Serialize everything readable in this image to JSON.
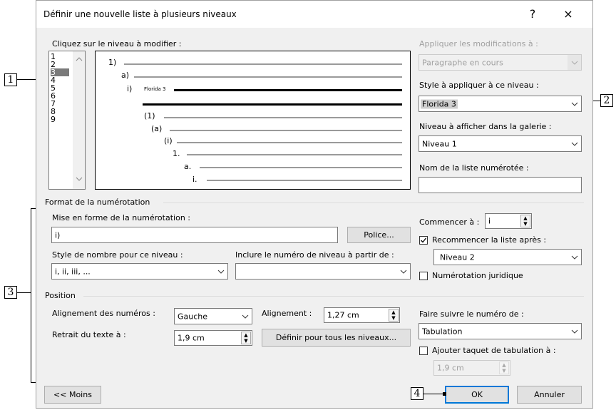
{
  "callouts": {
    "c1": "1",
    "c2": "2",
    "c3": "3",
    "c4": "4"
  },
  "dialog": {
    "title": "Définir une nouvelle liste à plusieurs niveaux",
    "help": "?",
    "close": "×"
  },
  "levels": {
    "label": "Cliquez sur le niveau à modifier :",
    "items": [
      "1",
      "2",
      "3",
      "4",
      "5",
      "6",
      "7",
      "8",
      "9"
    ],
    "selected": "3"
  },
  "preview": {
    "labels": [
      "1)",
      "a)",
      "i)",
      "(1)",
      "(a)",
      "(i)",
      "1.",
      "a.",
      "i."
    ],
    "style_tag": "Florida 3"
  },
  "apply": {
    "label": "Appliquer les modifications à :",
    "value": "Paragraphe en cours"
  },
  "style": {
    "label": "Style à appliquer à ce niveau :",
    "value": "Florida 3"
  },
  "gallery": {
    "label": "Niveau à afficher dans la galerie :",
    "value": "Niveau 1"
  },
  "list_name": {
    "label": "Nom de la liste numérotée :",
    "value": ""
  },
  "numbering": {
    "section": "Format de la numérotation",
    "format_label": "Mise en forme de la numérotation :",
    "format_value": "i)",
    "font_button": "Police...",
    "style_label": "Style de nombre pour ce niveau :",
    "style_value": "i, ii, iii, ...",
    "include_label": "Inclure le numéro de niveau à partir de :",
    "include_value": "",
    "start_label": "Commencer à :",
    "start_value": "i",
    "restart_label": "Recommencer la liste après :",
    "restart_checked": true,
    "restart_value": "Niveau 2",
    "legal_label": "Numérotation juridique",
    "legal_checked": false
  },
  "position": {
    "section": "Position",
    "align_label": "Alignement des numéros :",
    "align_value": "Gauche",
    "at_label": "Alignement :",
    "at_value": "1,27 cm",
    "indent_label": "Retrait du texte à :",
    "indent_value": "1,9 cm",
    "set_all_button": "Définir pour tous les niveaux...",
    "follow_label": "Faire suivre le numéro de :",
    "follow_value": "Tabulation",
    "tabstop_label": "Ajouter taquet de tabulation à :",
    "tabstop_checked": false,
    "tabstop_value": "1,9 cm"
  },
  "buttons": {
    "less": "<< Moins",
    "ok": "OK",
    "cancel": "Annuler"
  }
}
